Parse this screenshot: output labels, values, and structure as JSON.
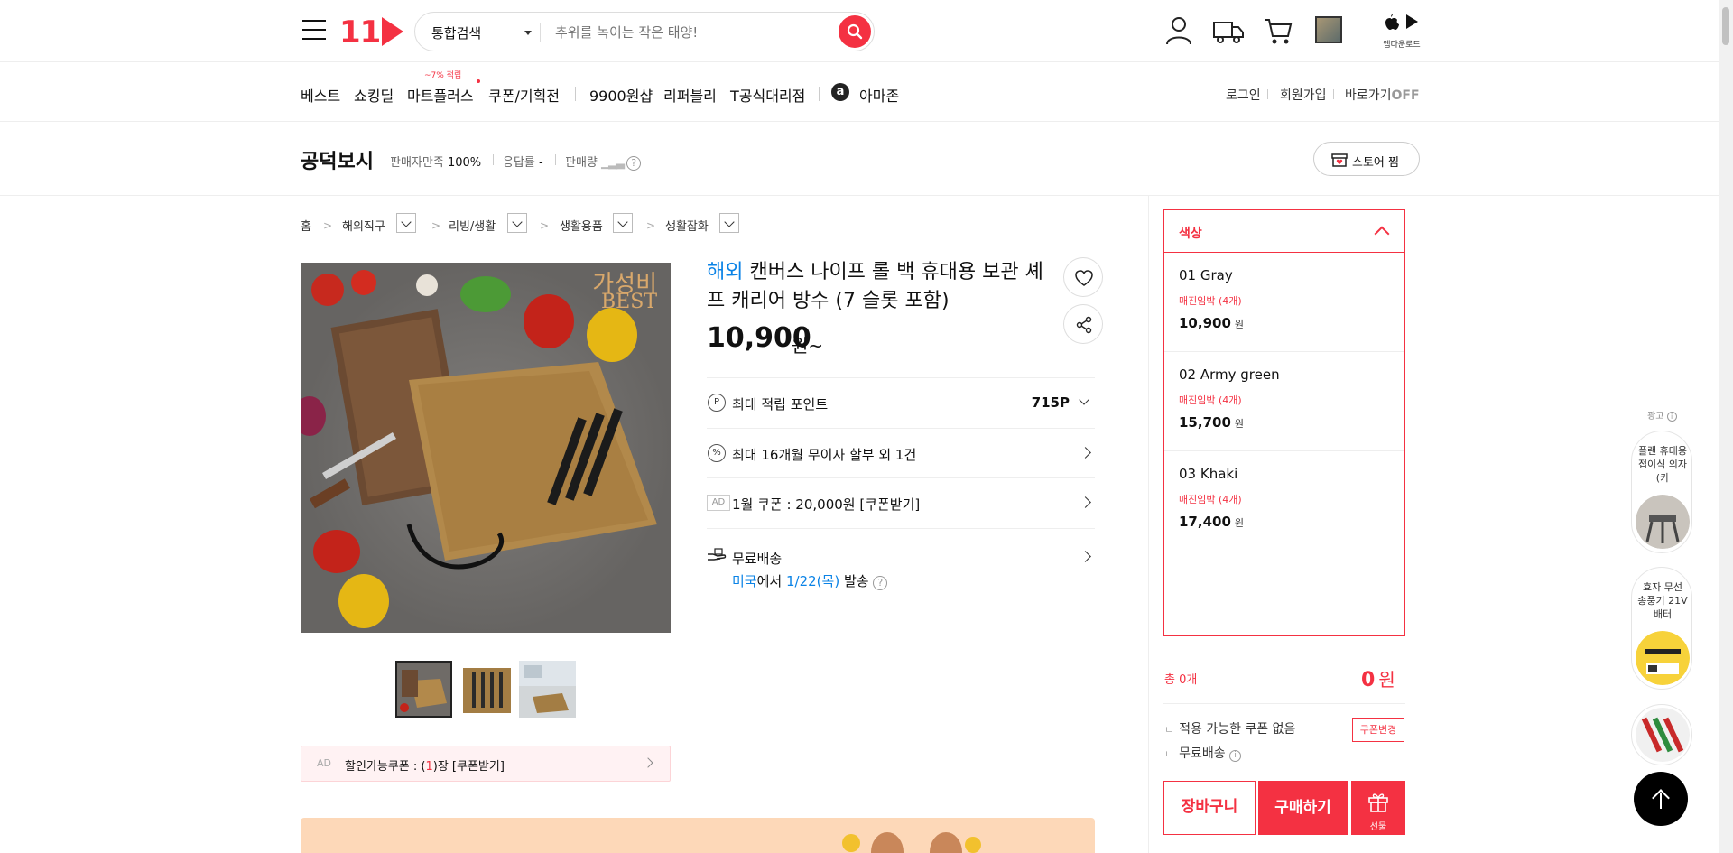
{
  "header": {
    "logo": "11",
    "search": {
      "category": "통합검색",
      "placeholder": "추위를 녹이는 작은 태양!"
    },
    "app_download_label": "앱다운로드"
  },
  "nav": {
    "items": [
      "베스트",
      "쇼킹딜",
      "마트플러스",
      "쿠폰/기획전",
      "9900원샵",
      "리퍼블리",
      "T공식대리점",
      "아마존"
    ],
    "mart_badge": "~7% 적립",
    "util": [
      "로그인",
      "회원가입",
      "바로가기"
    ],
    "shortcut_state": "OFF"
  },
  "store": {
    "name": "공덕보시",
    "satisfaction_label": "판매자만족",
    "satisfaction_value": "100%",
    "response_label": "응답률",
    "response_value": "-",
    "sales_label": "판매량",
    "favorite_label": "스토어 찜"
  },
  "breadcrumb": [
    "홈",
    "해외직구",
    "리빙/생활",
    "생활용품",
    "생활잡화"
  ],
  "product": {
    "overseas_tag": "해외",
    "title": "캔버스 나이프 롤 백 휴대용 보관 셰프 캐리어 방수 (7 슬롯 포함)",
    "price": "10,900",
    "price_unit": "원~",
    "image_badge_line1": "가성비",
    "image_badge_line2": "BEST",
    "point_label": "최대 적립 포인트",
    "point_value": "715P",
    "installment_label": "최대 16개월 무이자 할부 외 1건",
    "coupon_ad": "AD",
    "coupon_label": "1월 쿠폰 : 20,000원 [쿠폰받기]",
    "shipping_label": "무료배송",
    "shipping_origin": "미국",
    "shipping_mid": "에서 ",
    "shipping_date": "1/22(목)",
    "shipping_tail": " 발송",
    "discount_coupon_ad": "AD",
    "discount_coupon_prefix": "할인가능쿠폰 : (",
    "discount_coupon_count": "1",
    "discount_coupon_suffix": ")장 [쿠폰받기]"
  },
  "options": {
    "header": "색상",
    "items": [
      {
        "name": "01 Gray",
        "stock": "매진임박 (4개)",
        "price": "10,900",
        "unit": "원"
      },
      {
        "name": "02 Army green",
        "stock": "매진임박 (4개)",
        "price": "15,700",
        "unit": "원"
      },
      {
        "name": "03 Khaki",
        "stock": "매진임박 (4개)",
        "price": "17,400",
        "unit": "원"
      }
    ]
  },
  "order": {
    "total_count_label": "총 0개",
    "total_price": "0",
    "total_unit": "원",
    "no_coupon": "적용 가능한 쿠폰 없음",
    "coupon_change": "쿠폰변경",
    "free_shipping": "무료배송",
    "cart_label": "장바구니",
    "buy_label": "구매하기",
    "gift_label": "선물"
  },
  "ads": {
    "label": "광고",
    "items": [
      {
        "text": "플랜 휴대용 접이식 의자(카"
      },
      {
        "text": "효자 무선 송풍기 21V 배터"
      }
    ]
  },
  "colors": {
    "accent": "#f43142",
    "link_blue": "#0b83e6"
  }
}
